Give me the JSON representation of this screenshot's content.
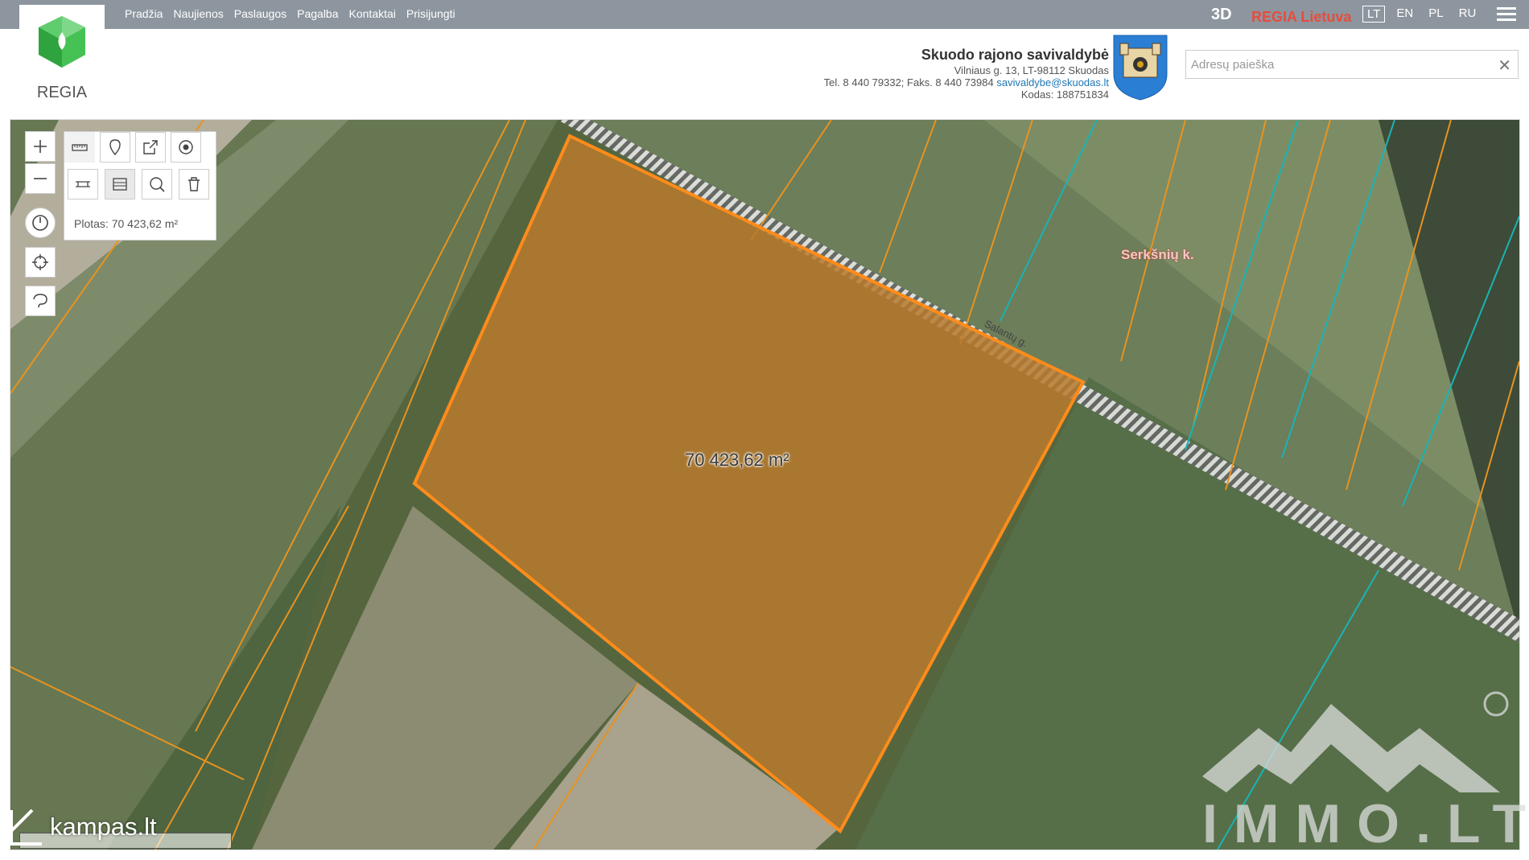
{
  "nav": {
    "items": [
      "Pradžia",
      "Naujienos",
      "Paslaugos",
      "Pagalba",
      "Kontaktai",
      "Prisijungti"
    ],
    "btn_3d": "3D",
    "brand": "REGIA Lietuva",
    "languages": [
      "LT",
      "EN",
      "PL",
      "RU"
    ],
    "active_language": "LT"
  },
  "logo": {
    "text": "REGIA"
  },
  "municipality": {
    "name": "Skuodo rajono savivaldybė",
    "address": "Vilniaus g. 13, LT-98112 Skuodas",
    "phone": "Tel. 8 440 79332; Faks. 8 440 73984",
    "email": "savivaldybe@skuodas.lt",
    "code": "Kodas: 188751834"
  },
  "search": {
    "placeholder": "Adresų paieška",
    "value": ""
  },
  "map": {
    "measure_result": "Plotas: 70 423,62 m²",
    "area_label": "70 423,62 m²",
    "place_label": "Serkšnių k.",
    "road_label": "Salantų g."
  },
  "watermarks": {
    "immo": "IMMO.LT",
    "kampas": "kampas.lt"
  },
  "colors": {
    "topbar": "#8d969f",
    "brand": "#e74c3c",
    "parcel_fill": "#b97a2e",
    "parcel_outline": "#ff8c1a",
    "cadastre_lines": "#e8931f",
    "cadastre_cyan": "#19b4b4"
  },
  "icons": [
    "zoom-in-icon",
    "zoom-out-icon",
    "history-icon",
    "locate-icon",
    "lasso-icon",
    "measure-icon",
    "marker-icon",
    "share-icon",
    "target-icon",
    "measure-distance-icon",
    "measure-area-icon",
    "search-area-icon",
    "trash-icon"
  ]
}
